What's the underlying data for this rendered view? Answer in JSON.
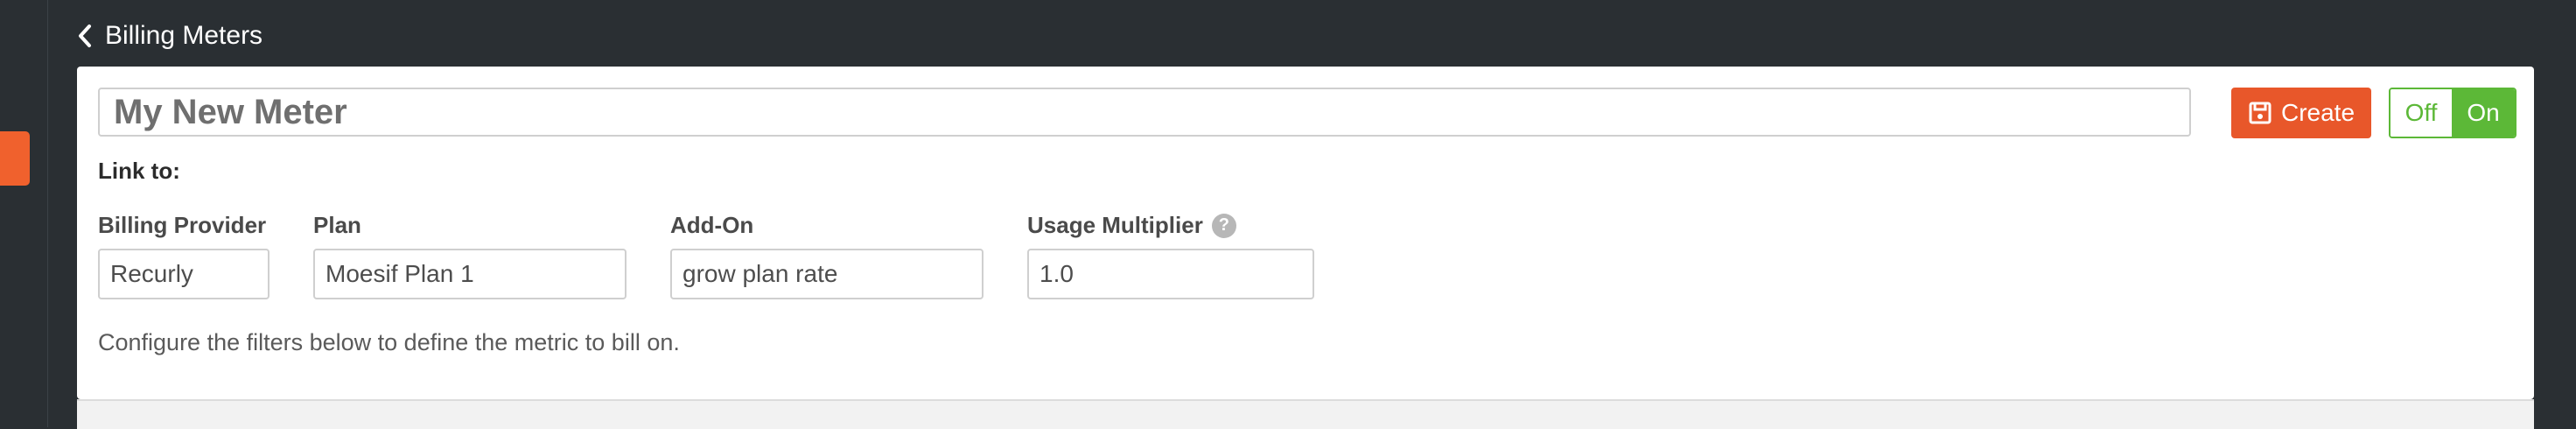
{
  "header": {
    "back_label": "Billing Meters"
  },
  "meter": {
    "name": "My New Meter"
  },
  "actions": {
    "create_label": "Create",
    "toggle_off": "Off",
    "toggle_on": "On"
  },
  "link": {
    "heading": "Link to:",
    "billing_provider": {
      "label": "Billing Provider",
      "value": "Recurly"
    },
    "plan": {
      "label": "Plan",
      "value": "Moesif Plan 1"
    },
    "addon": {
      "label": "Add-On",
      "value": "grow plan rate"
    },
    "multiplier": {
      "label": "Usage Multiplier",
      "value": "1.0",
      "help_icon": "?"
    }
  },
  "hint": "Configure the filters below to define the metric to bill on.",
  "colors": {
    "accent": "#e8572a",
    "toggle_on": "#5cb837",
    "background": "#2a2f33"
  }
}
